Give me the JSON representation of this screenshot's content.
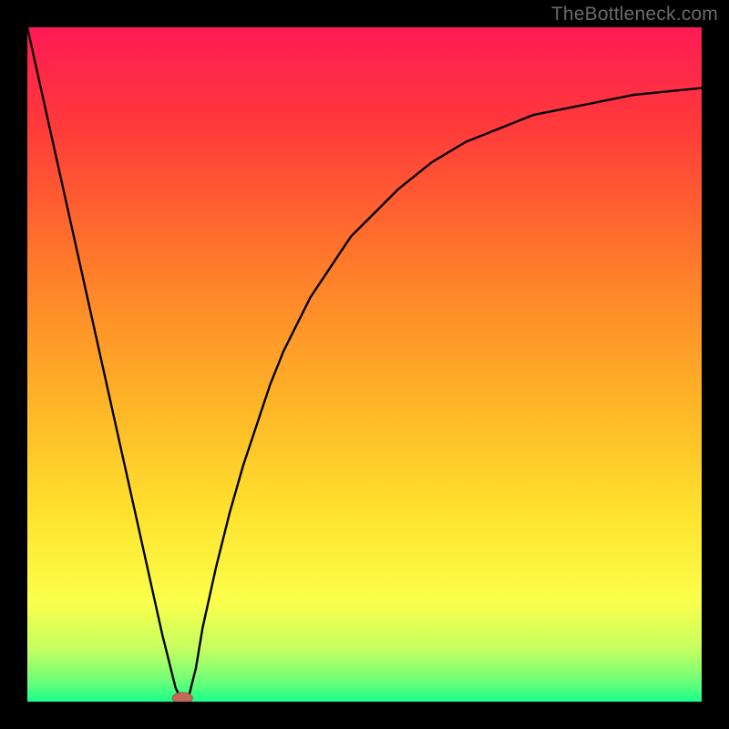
{
  "watermark": "TheBottleneck.com",
  "colors": {
    "frame": "#000000",
    "curve": "#000000",
    "marker_fill": "#c26a5a",
    "marker_stroke": "#b05043",
    "gradient_stops": [
      {
        "offset": 0.0,
        "color": "#ff1a54"
      },
      {
        "offset": 0.15,
        "color": "#ff3b3a"
      },
      {
        "offset": 0.35,
        "color": "#ff7a2a"
      },
      {
        "offset": 0.55,
        "color": "#ffb327"
      },
      {
        "offset": 0.72,
        "color": "#ffe22e"
      },
      {
        "offset": 0.85,
        "color": "#fbff4a"
      },
      {
        "offset": 0.92,
        "color": "#c8ff60"
      },
      {
        "offset": 0.97,
        "color": "#6cff78"
      },
      {
        "offset": 1.0,
        "color": "#19ff8a"
      }
    ]
  },
  "chart_data": {
    "type": "line",
    "title": "",
    "xlabel": "",
    "ylabel": "",
    "xlim": [
      0,
      100
    ],
    "ylim": [
      0,
      100
    ],
    "x": [
      0,
      2,
      4,
      6,
      8,
      10,
      12,
      14,
      16,
      18,
      20,
      21,
      22,
      23,
      24,
      25,
      26,
      28,
      30,
      32,
      34,
      36,
      38,
      40,
      42,
      44,
      46,
      48,
      50,
      55,
      60,
      65,
      70,
      75,
      80,
      85,
      90,
      95,
      100
    ],
    "values": [
      100,
      91,
      82,
      73,
      64,
      55,
      46,
      37,
      28,
      19,
      10,
      6,
      2,
      0,
      1,
      5,
      11,
      20,
      28,
      35,
      41,
      47,
      52,
      56,
      60,
      63,
      66,
      69,
      71,
      76,
      80,
      83,
      85,
      87,
      88,
      89,
      90,
      90.5,
      91
    ],
    "marker": {
      "x": 23,
      "y": 0
    },
    "grid": false,
    "legend": false
  }
}
